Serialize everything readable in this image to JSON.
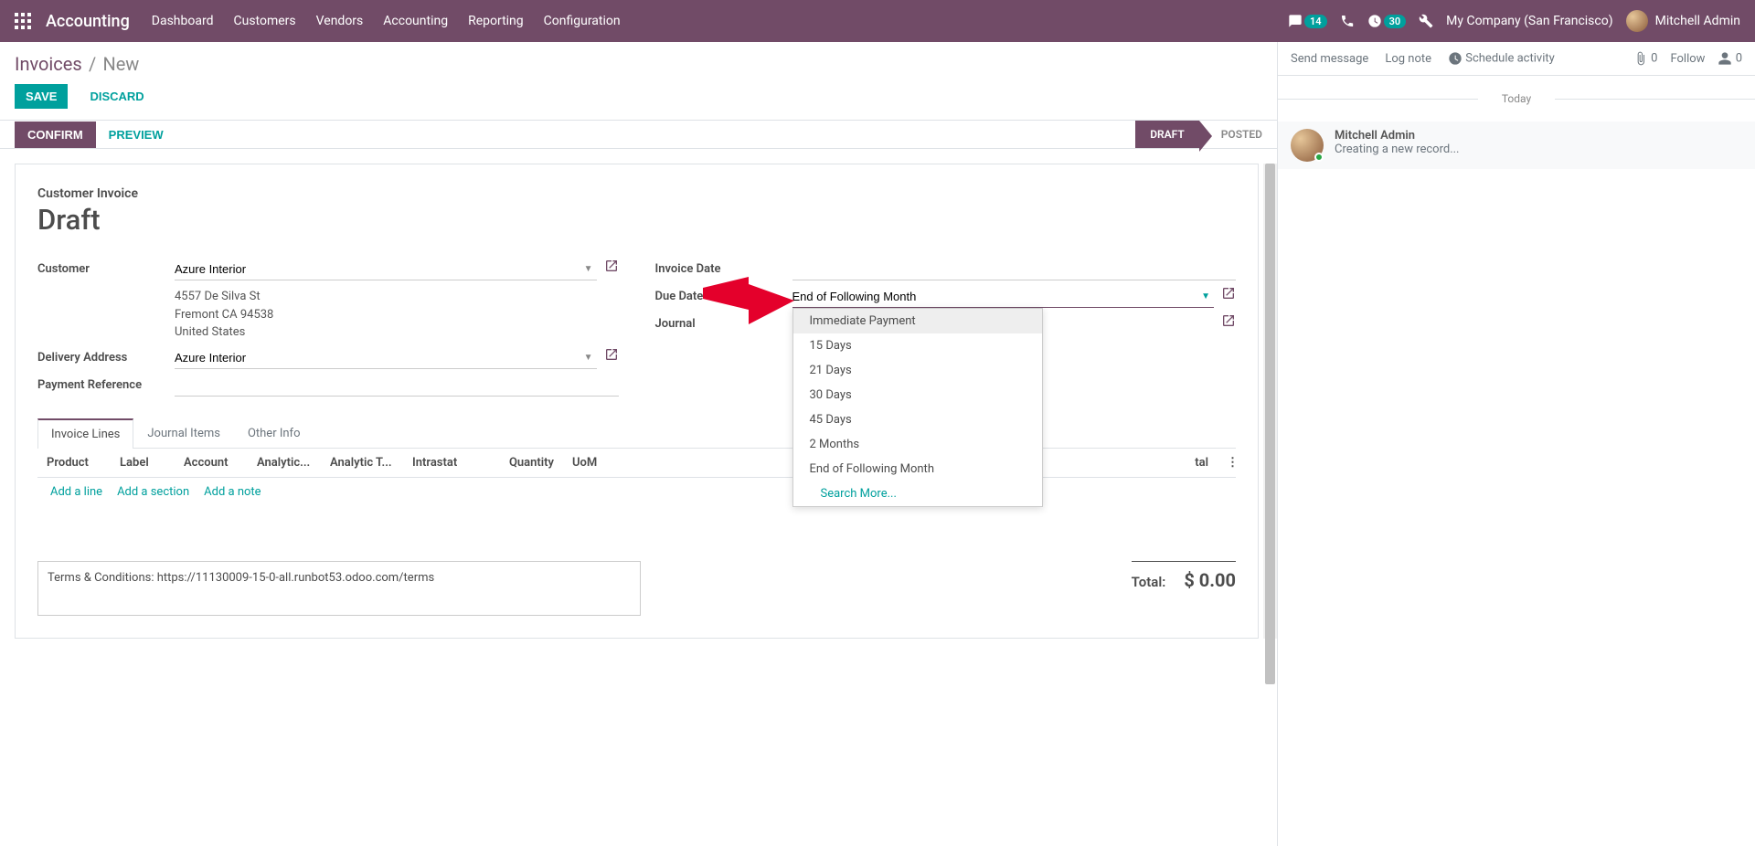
{
  "topnav": {
    "brand": "Accounting",
    "menu": [
      "Dashboard",
      "Customers",
      "Vendors",
      "Accounting",
      "Reporting",
      "Configuration"
    ],
    "msg_badge": "14",
    "activity_badge": "30",
    "company": "My Company (San Francisco)",
    "user": "Mitchell Admin"
  },
  "breadcrumb": {
    "parent": "Invoices",
    "current": "New"
  },
  "actions": {
    "save": "SAVE",
    "discard": "DISCARD"
  },
  "statusbar": {
    "confirm": "CONFIRM",
    "preview": "PREVIEW",
    "draft": "DRAFT",
    "posted": "POSTED"
  },
  "sheet": {
    "title_small": "Customer Invoice",
    "title_big": "Draft",
    "labels": {
      "customer": "Customer",
      "delivery": "Delivery Address",
      "payref": "Payment Reference",
      "invdate": "Invoice Date",
      "duedate": "Due Date",
      "journal": "Journal"
    },
    "customer": "Azure Interior",
    "address": {
      "line1": "4557 De Silva St",
      "line2": "Fremont CA 94538",
      "line3": "United States"
    },
    "delivery": "Azure Interior",
    "duedate_value": "End of Following Month"
  },
  "dropdown": {
    "options": [
      "Immediate Payment",
      "15 Days",
      "21 Days",
      "30 Days",
      "45 Days",
      "2 Months",
      "End of Following Month"
    ],
    "search_more": "Search More..."
  },
  "tabs": [
    "Invoice Lines",
    "Journal Items",
    "Other Info"
  ],
  "columns": {
    "product": "Product",
    "label": "Label",
    "account": "Account",
    "analytic": "Analytic...",
    "analytict": "Analytic T...",
    "intrastat": "Intrastat",
    "qty": "Quantity",
    "uom": "UoM",
    "tal": "tal"
  },
  "addlinks": {
    "line": "Add a line",
    "section": "Add a section",
    "note": "Add a note"
  },
  "terms": "Terms & Conditions: https://11130009-15-0-all.runbot53.odoo.com/terms",
  "totals": {
    "label": "Total:",
    "value": "$ 0.00"
  },
  "chatter": {
    "send": "Send message",
    "log": "Log note",
    "schedule": "Schedule activity",
    "follow": "Follow",
    "attach_count": "0",
    "follower_count": "0",
    "today": "Today",
    "msg": {
      "author": "Mitchell Admin",
      "text": "Creating a new record..."
    }
  }
}
